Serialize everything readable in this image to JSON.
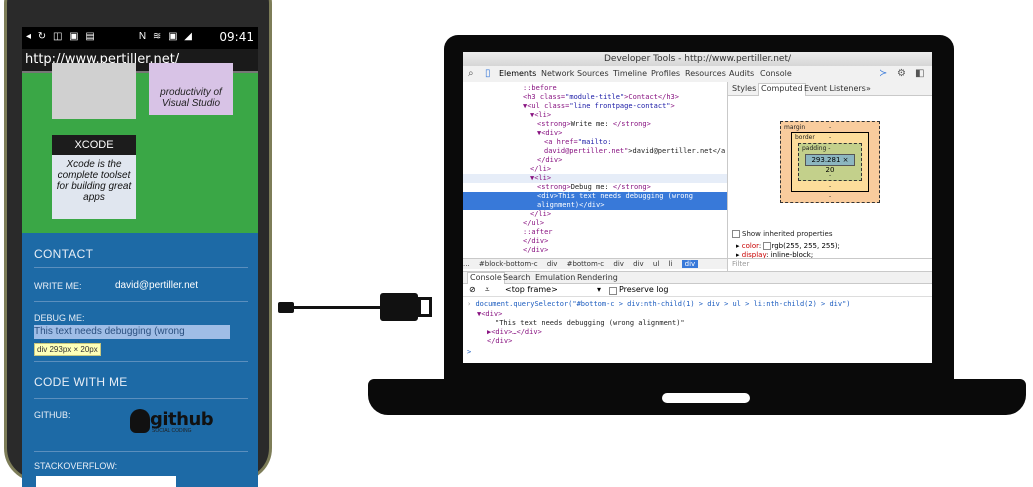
{
  "phone": {
    "status": {
      "left_icons": "◂ ↻ ◫ ▣ ▤",
      "right_icons": "N ≋ ▣ ◢",
      "time": "09:41"
    },
    "url": "http://www.pertiller.net/",
    "cards": {
      "purple_text": "productivity of Visual Studio",
      "xcode_header": "XCODE",
      "xcode_body": "Xcode is the complete toolset for building great apps"
    },
    "contact": {
      "title": "CONTACT",
      "write_label": "WRITE ME:",
      "write_value": "david@pertiller.net",
      "debug_label": "DEBUG ME:",
      "debug_value": "This text needs debugging (wrong alignment)",
      "tooltip_tag": "div",
      "tooltip_size": "293px × 20px"
    },
    "code": {
      "title": "CODE WITH ME",
      "github_label": "GITHUB:",
      "github_logo": "github",
      "github_sub": "SOCIAL CODING",
      "so_label": "STACKOVERFLOW:"
    }
  },
  "devtools": {
    "title": "Developer Tools - http://www.pertiller.net/",
    "tabs": [
      "Elements",
      "Network",
      "Sources",
      "Timeline",
      "Profiles",
      "Resources",
      "Audits",
      "Console"
    ],
    "dom": [
      {
        "indent": 0,
        "html": [
          "::before",
          "",
          "",
          ""
        ]
      },
      {
        "indent": 0,
        "html": [
          "<h3 class=",
          "\"module-title\"",
          ">Contact</h3>",
          ""
        ]
      },
      {
        "indent": 0,
        "html": [
          "▼<ul class=",
          "\"line frontpage-contact\"",
          ">",
          ""
        ]
      },
      {
        "indent": 1,
        "html": [
          "▼<li>",
          "",
          "",
          ""
        ]
      },
      {
        "indent": 2,
        "html": [
          "<strong>",
          "Write me: ",
          "</strong>",
          ""
        ]
      },
      {
        "indent": 2,
        "html": [
          "▼<div>",
          "",
          "",
          ""
        ]
      },
      {
        "indent": 3,
        "html": [
          "<a href=",
          "\"mailto:",
          "",
          ""
        ]
      },
      {
        "indent": 3,
        "html": [
          "david@pertiller.net\"",
          ">david@pertiller.net</a",
          "",
          ""
        ]
      },
      {
        "indent": 2,
        "html": [
          "</div>",
          "",
          "",
          ""
        ]
      },
      {
        "indent": 1,
        "html": [
          "</li>",
          "",
          "",
          ""
        ]
      },
      {
        "indent": 1,
        "html": [
          "▼<li>",
          "",
          "",
          ""
        ]
      },
      {
        "indent": 2,
        "html": [
          "<strong>",
          "Debug me: ",
          "</strong>",
          ""
        ]
      },
      {
        "indent": 2,
        "html": [
          "<div>This text needs debugging (wrong",
          "",
          "",
          ""
        ]
      },
      {
        "indent": 2,
        "html": [
          "alignment)</div>",
          "",
          "",
          ""
        ]
      },
      {
        "indent": 1,
        "html": [
          "</li>",
          "",
          "",
          ""
        ]
      },
      {
        "indent": 0,
        "html": [
          "</ul>",
          "",
          "",
          ""
        ]
      },
      {
        "indent": 0,
        "html": [
          "::after",
          "",
          "",
          ""
        ]
      },
      {
        "indent": 0,
        "html": [
          "</div>",
          "",
          "",
          ""
        ]
      },
      {
        "indent": 0,
        "html": [
          "</div>",
          "",
          "",
          ""
        ]
      }
    ],
    "crumbs": [
      "...",
      "#block-bottom-c",
      "div",
      "#bottom-c",
      "div",
      "div",
      "ul",
      "li",
      "div"
    ],
    "side_tabs": [
      "Styles",
      "Computed",
      "Event Listeners",
      "»"
    ],
    "box_model": {
      "margin": "margin",
      "border": "border",
      "padding": "padding -",
      "content": "293.281 × 20",
      "dash": "-"
    },
    "inherited": "Show inherited properties",
    "props": [
      {
        "name": "color",
        "value": "rgb(255, 255, 255);"
      },
      {
        "name": "display",
        "value": "inline-block;"
      }
    ],
    "filter": "Filter",
    "console_tabs": [
      "Console",
      "Search",
      "Emulation",
      "Rendering"
    ],
    "frame": "<top frame>",
    "preserve": "Preserve log",
    "console": {
      "cmd": "document.querySelector(\"#bottom-c > div:nth-child(1) > div > ul > li:nth-child(2) > div\")",
      "out1": "▼<div>",
      "out2": "\"This text needs debugging (wrong alignment)\"",
      "out3": "▶<div>…</div>",
      "out4": "</div>",
      "prompt": ">"
    }
  },
  "colors": {
    "green": "#3aa746",
    "blue": "#1d6aa6",
    "select": "#3879d9"
  }
}
